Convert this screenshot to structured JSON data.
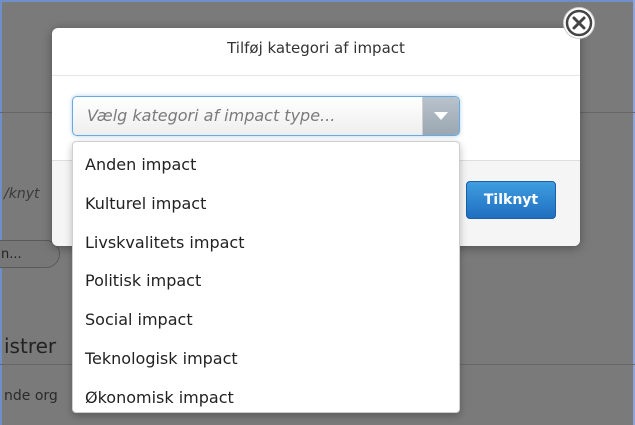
{
  "modal": {
    "title": "Tilføj kategori af impact",
    "attach_label": "Tilknyt",
    "close_icon": "close-circle-icon"
  },
  "select": {
    "placeholder": "Vælg kategori af impact type...",
    "arrow_icon": "chevron-down-icon",
    "options": [
      "Anden impact",
      "Kulturel impact",
      "Livskvalitets impact",
      "Politisk impact",
      "Social impact",
      "Teknologisk impact",
      "Økonomisk impact"
    ]
  },
  "background": {
    "fragment_1": "/knyt",
    "fragment_2": "n...",
    "fragment_3": "istrer",
    "fragment_4": "nde org"
  },
  "colors": {
    "overlay": "#7a7a7a",
    "primary_button": "#2a7fd0",
    "select_focus": "#6aa9de"
  }
}
